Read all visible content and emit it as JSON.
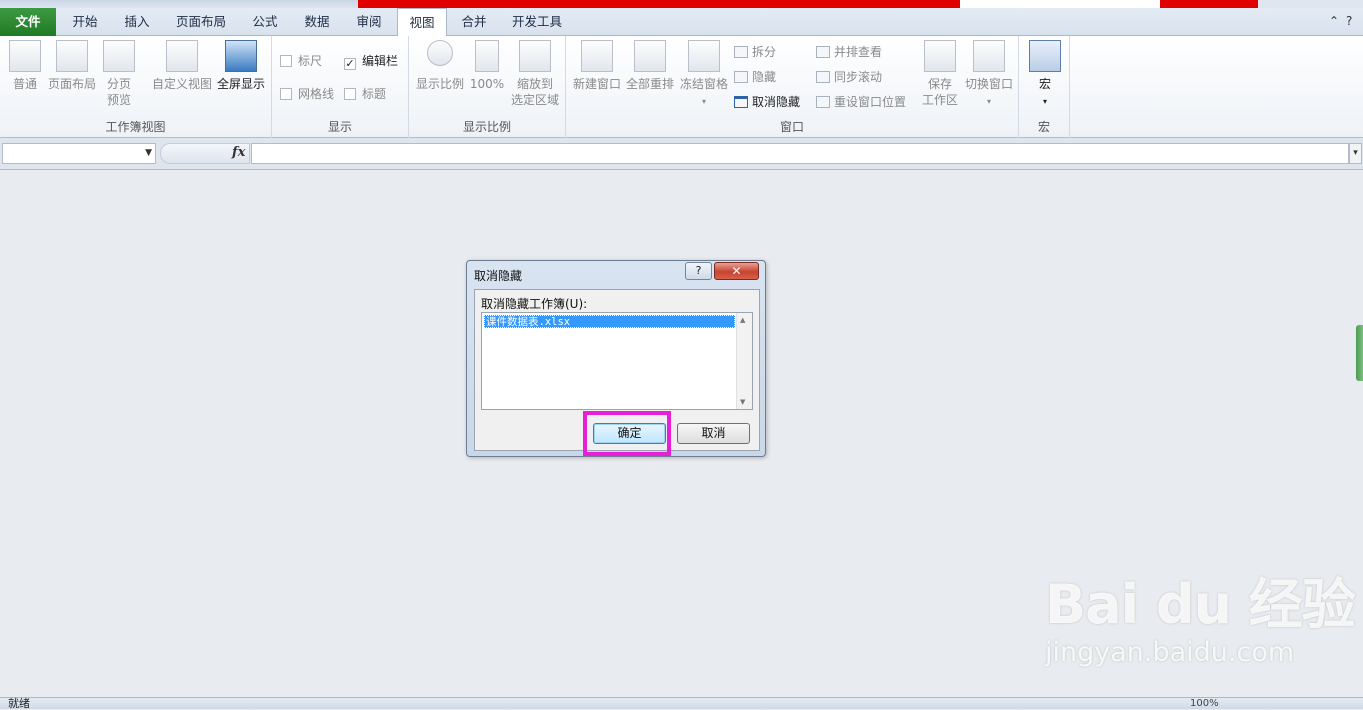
{
  "tabs": {
    "file": "文件",
    "items": [
      "开始",
      "插入",
      "页面布局",
      "公式",
      "数据",
      "审阅",
      "视图",
      "合并",
      "开发工具"
    ],
    "active": "视图"
  },
  "ribbon": {
    "workbook_views": {
      "label": "工作簿视图",
      "normal": "普通",
      "page_layout": "页面布局",
      "page_break_1": "分页",
      "page_break_2": "预览",
      "custom_views": "自定义视图",
      "full_screen": "全屏显示"
    },
    "show": {
      "label": "显示",
      "ruler": "标尺",
      "formula_bar": "编辑栏",
      "gridlines": "网格线",
      "headings": "标题",
      "formula_bar_checked": true
    },
    "zoom": {
      "label": "显示比例",
      "zoom": "显示比例",
      "hundred": "100%",
      "zoom_sel_1": "缩放到",
      "zoom_sel_2": "选定区域"
    },
    "window": {
      "label": "窗口",
      "new_window": "新建窗口",
      "arrange_all": "全部重排",
      "freeze_panes": "冻结窗格",
      "split": "拆分",
      "hide": "隐藏",
      "unhide": "取消隐藏",
      "side_by_side": "并排查看",
      "sync_scroll": "同步滚动",
      "reset_position": "重设窗口位置",
      "save_ws_1": "保存",
      "save_ws_2": "工作区",
      "switch_windows": "切换窗口"
    },
    "macros": {
      "label": "宏",
      "macros": "宏"
    }
  },
  "formula_bar": {
    "fx": "fx",
    "name_box_value": "",
    "formula_value": ""
  },
  "dialog": {
    "title": "取消隐藏",
    "help": "?",
    "close": "✕",
    "list_label": "取消隐藏工作簿(U):",
    "items": [
      "课件数据表.xlsx"
    ],
    "ok": "确定",
    "cancel": "取消"
  },
  "watermark": {
    "logo": "Bai du 经验",
    "url": "jingyan.baidu.com"
  },
  "statusbar": {
    "ready": "就绪",
    "zoom": "100%"
  },
  "colors": {
    "file_tab": "#207a25",
    "highlight": "#e81ed8",
    "selection": "#3399ff"
  }
}
